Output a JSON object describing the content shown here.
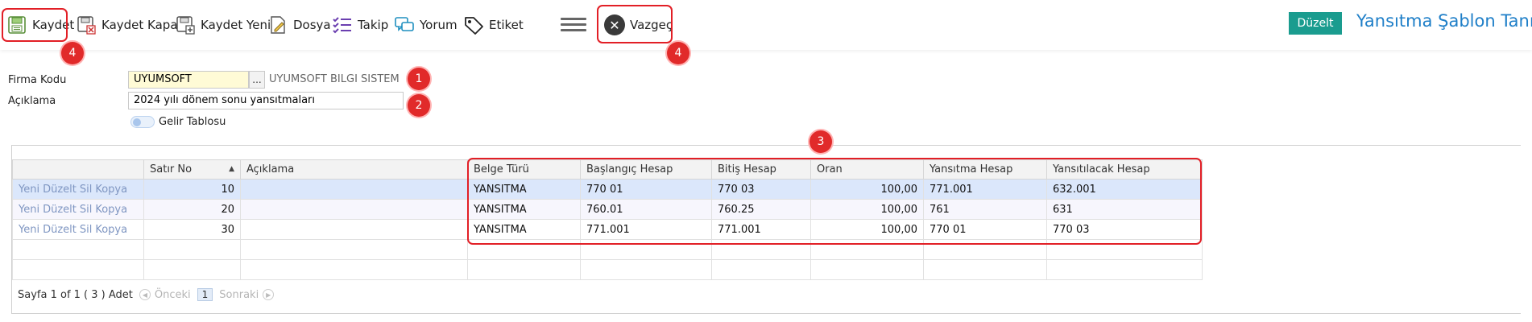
{
  "toolbar": {
    "save": "Kaydet",
    "save_close": "Kaydet Kapat",
    "save_new": "Kaydet Yeni",
    "file": "Dosya",
    "follow": "Takip",
    "comment": "Yorum",
    "tag": "Etiket",
    "cancel": "Vazgeç"
  },
  "header": {
    "edit": "Düzelt",
    "title": "Yansıtma Şablon Tanım"
  },
  "form": {
    "firma_label": "Firma Kodu",
    "firma_value": "UYUMSOFT",
    "firma_lookup": "...",
    "firma_name": "UYUMSOFT BILGI SISTEM",
    "desc_label": "Açıklama",
    "desc_value": "2024 yılı dönem sonu yansıtmaları",
    "toggle_label": "Gelir Tablosu"
  },
  "annotations": [
    "1",
    "2",
    "3",
    "4",
    "4"
  ],
  "grid": {
    "columns": [
      "",
      "Satır No",
      "Açıklama",
      "Belge Türü",
      "Başlangıç Hesap",
      "Bitiş Hesap",
      "Oran",
      "Yansıtma Hesap",
      "Yansıtılacak Hesap"
    ],
    "row_actions": [
      "Yeni",
      "Düzelt",
      "Sil",
      "Kopya"
    ],
    "rows": [
      {
        "satir": "10",
        "aciklama": "",
        "belge": "YANSITMA",
        "bas": "770 01",
        "bit": "770 03",
        "oran": "100,00",
        "yans": "771.001",
        "yansilacak": "632.001"
      },
      {
        "satir": "20",
        "aciklama": "",
        "belge": "YANSITMA",
        "bas": "760.01",
        "bit": "760.25",
        "oran": "100,00",
        "yans": "761",
        "yansilacak": "631"
      },
      {
        "satir": "30",
        "aciklama": "",
        "belge": "YANSITMA",
        "bas": "771.001",
        "bit": "771.001",
        "oran": "100,00",
        "yans": "770 01",
        "yansilacak": "770 03"
      }
    ],
    "pager": {
      "info": "Sayfa 1 of 1 ( 3 ) Adet",
      "prev": "Önceki",
      "page": "1",
      "next": "Sonraki"
    }
  },
  "colors": {
    "accent": "#1a9c8f",
    "title": "#1f7fc8",
    "annotation": "#e21f26",
    "selected_row": "#dbe7fb",
    "required_field": "#fffbd6"
  }
}
